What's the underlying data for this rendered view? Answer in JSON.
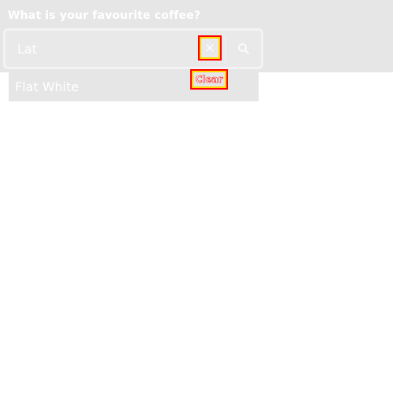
{
  "question": "What is your favourite coffee?",
  "search": {
    "value": "Lat",
    "clear_tooltip": "Clear"
  },
  "suggestions": [
    {
      "label": "Flat White"
    }
  ],
  "colors": {
    "band": "#e6e6e6",
    "text": "#ffffff",
    "highlight_red": "#ff0000",
    "highlight_yellow": "#ffd800"
  },
  "icons": {
    "clear": "close-icon",
    "search": "search-icon"
  }
}
